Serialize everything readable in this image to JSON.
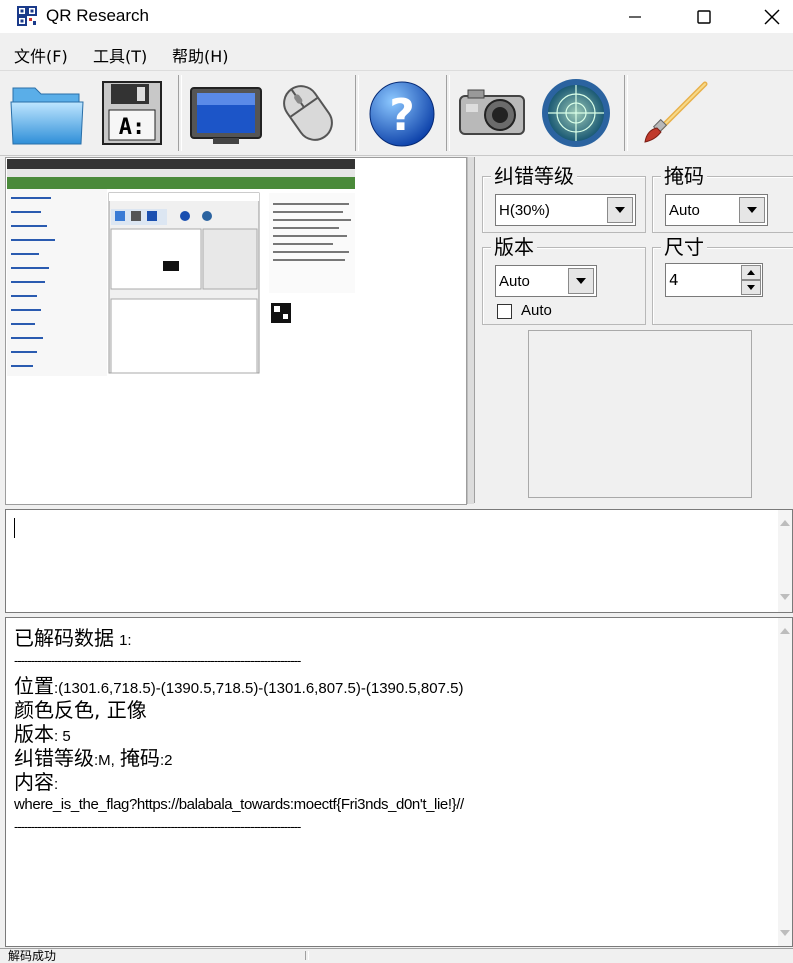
{
  "window": {
    "title": "QR Research"
  },
  "menu": {
    "items": [
      "文件(F)",
      "工具(T)",
      "帮助(H)"
    ]
  },
  "toolbar": {
    "buttons": [
      "open-folder-icon",
      "save-disk-icon",
      "monitor-icon",
      "mouse-icon",
      "help-icon",
      "camera-icon",
      "radar-icon",
      "paintbrush-icon"
    ]
  },
  "settings": {
    "ec_level": {
      "label": "纠错等级",
      "value": "H(30%)"
    },
    "mask": {
      "label": "掩码",
      "value": "Auto"
    },
    "version": {
      "label": "版本",
      "value": "Auto",
      "checkbox_label": "Auto"
    },
    "size": {
      "label": "尺寸",
      "value": "4"
    }
  },
  "input": {
    "value": ""
  },
  "output": {
    "header_label": "已解码数据",
    "header_count": "1:",
    "separator": "--------------------------------------------------------------------------------------",
    "position_label": "位置",
    "position_value": ":(1301.6,718.5)-(1390.5,718.5)-(1301.6,807.5)-(1390.5,807.5)",
    "color_line": "颜色反色, 正像",
    "version_label": "版本",
    "version_value": ": 5",
    "ec_label": "纠错等级",
    "ec_value": ":M,",
    "mask_label": "掩码",
    "mask_value": ":2",
    "content_label": "内容",
    "content_colon": ":",
    "content_value": "where_is_the_flag?https://balabala_towards:moectf{Fri3nds_d0n't_lie!}//"
  },
  "status": {
    "text": "解码成功"
  },
  "colors": {
    "accent": "#1a5fb4",
    "background": "#f0f0f0"
  }
}
